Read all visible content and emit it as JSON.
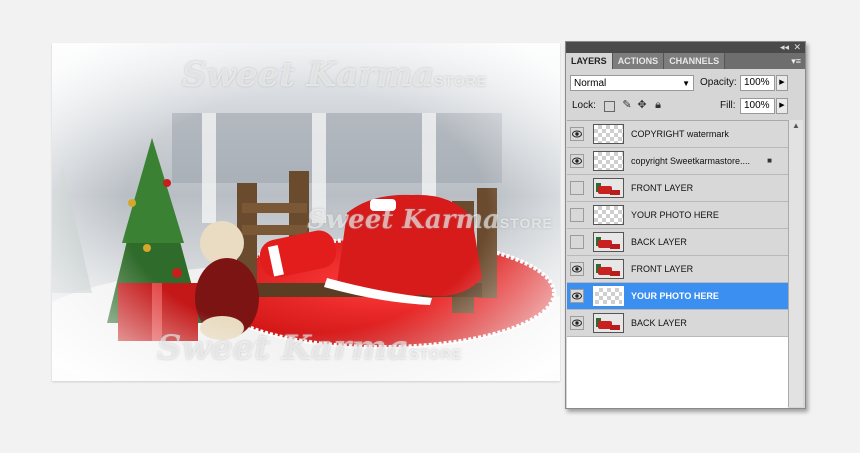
{
  "watermark": {
    "script": "Sweet Karma",
    "store": "STORE"
  },
  "panel": {
    "tabs": [
      {
        "label": "LAYERS",
        "active": true
      },
      {
        "label": "ACTIONS",
        "active": false
      },
      {
        "label": "CHANNELS",
        "active": false
      }
    ],
    "collapse_glyph": "◂◂",
    "close_glyph": "✕",
    "menu_glyph": "▾≡",
    "blend_mode": "Normal",
    "opacity_label": "Opacity:",
    "opacity_value": "100%",
    "lock_label": "Lock:",
    "fill_label": "Fill:",
    "fill_value": "100%"
  },
  "layers": [
    {
      "name": "COPYRIGHT watermark",
      "visible": true,
      "thumb": "transparent",
      "selected": false,
      "locked": false
    },
    {
      "name": "copyright Sweetkarmastore....",
      "visible": true,
      "thumb": "transparent",
      "selected": false,
      "locked": true
    },
    {
      "name": "FRONT LAYER",
      "visible": false,
      "thumb": "image",
      "selected": false,
      "locked": false
    },
    {
      "name": "YOUR PHOTO HERE",
      "visible": false,
      "thumb": "transparent",
      "selected": false,
      "locked": false
    },
    {
      "name": "BACK LAYER",
      "visible": false,
      "thumb": "image",
      "selected": false,
      "locked": false
    },
    {
      "name": "FRONT LAYER",
      "visible": true,
      "thumb": "image",
      "selected": false,
      "locked": false
    },
    {
      "name": "YOUR PHOTO HERE",
      "visible": true,
      "thumb": "transparent",
      "selected": true,
      "locked": false
    },
    {
      "name": "BACK LAYER",
      "visible": true,
      "thumb": "image",
      "selected": false,
      "locked": false
    }
  ],
  "colors": {
    "selection": "#3b8ff0",
    "blanket_red": "#e01e1e"
  }
}
